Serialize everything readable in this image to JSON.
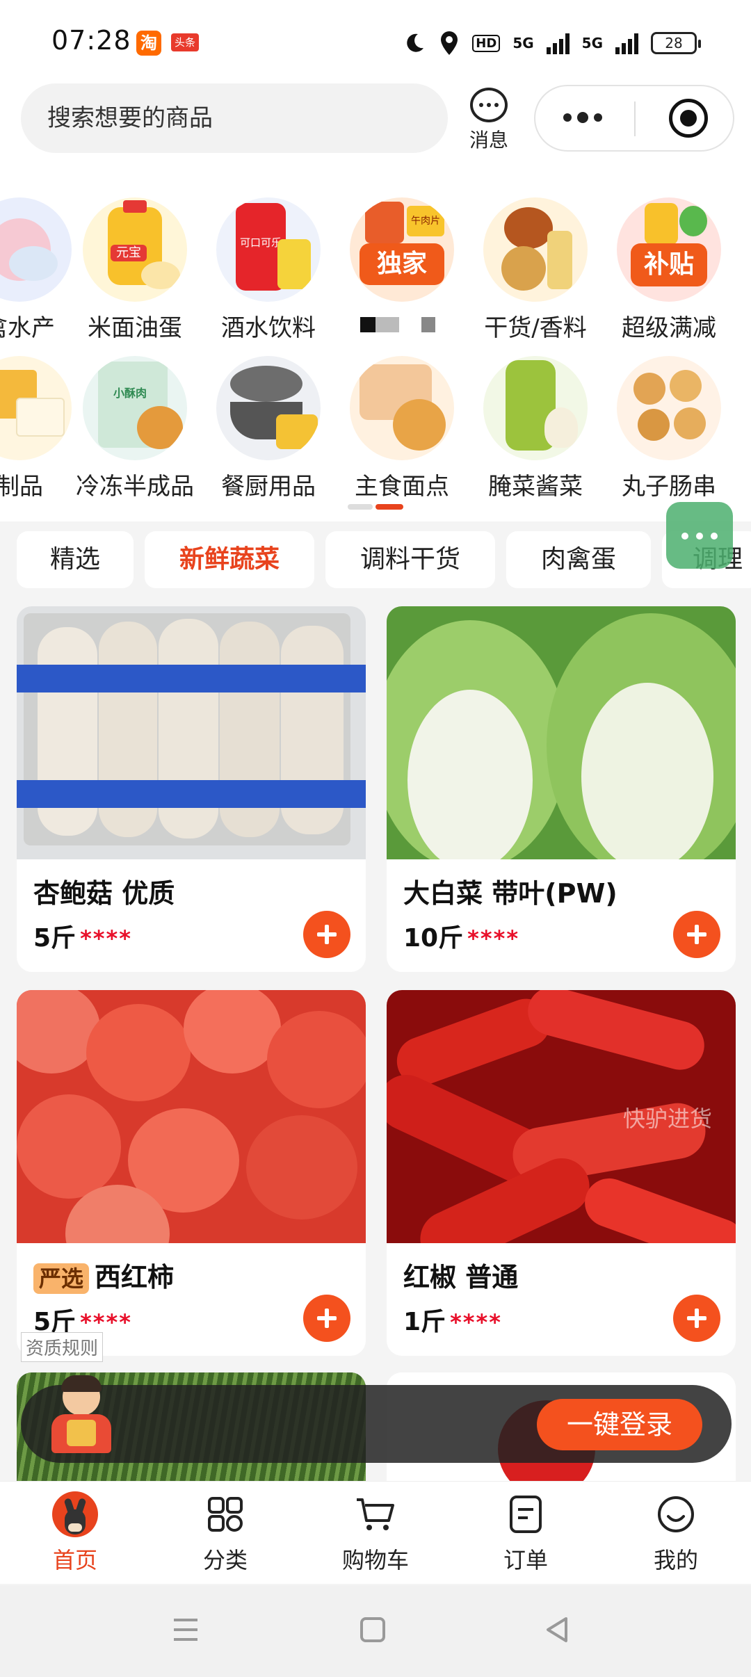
{
  "status_bar": {
    "time": "07:28",
    "taobao_icon": "淘",
    "toutiao_icon": "头条",
    "hd": "HD",
    "signal_1": "5G",
    "signal_2": "5G",
    "battery": "28"
  },
  "header": {
    "search_placeholder": "搜索想要的商品",
    "message_label": "消息"
  },
  "categories": {
    "row1": [
      "禽水产",
      "米面油蛋",
      "酒水饮料",
      "独家",
      "干货/香料",
      "超级满减"
    ],
    "row1_badges": {
      "exclusive": "独家",
      "subsidy": "补贴",
      "brand_yuanbao": "元宝",
      "cola": "可口可乐",
      "ham": "午肉片"
    },
    "row2": [
      "制品",
      "冷冻半成品",
      "餐厨用品",
      "主食面点",
      "腌菜酱菜",
      "丸子肠串"
    ],
    "row2_badges": {
      "small_pork": "小酥肉"
    }
  },
  "tabs": [
    {
      "label": "精选",
      "active": false
    },
    {
      "label": "新鲜蔬菜",
      "active": true
    },
    {
      "label": "调料干货",
      "active": false
    },
    {
      "label": "肉禽蛋",
      "active": false
    },
    {
      "label": "调理",
      "active": false
    }
  ],
  "products": [
    {
      "name": "杏鲍菇 优质",
      "qty": "5斤",
      "price": "****"
    },
    {
      "name": "大白菜 带叶(PW)",
      "qty": "10斤",
      "price": "****"
    },
    {
      "name": "西红柿",
      "badge": "严选",
      "qty": "5斤",
      "price": "****"
    },
    {
      "name": "红椒 普通",
      "qty": "1斤",
      "price": "****",
      "watermark": "快驴进货"
    }
  ],
  "rule_label": "资质规则",
  "login_bar": {
    "button": "一键登录"
  },
  "nav": [
    {
      "label": "首页",
      "icon": "donkey-home-icon",
      "active": true
    },
    {
      "label": "分类",
      "icon": "grid-icon",
      "active": false
    },
    {
      "label": "购物车",
      "icon": "cart-icon",
      "active": false
    },
    {
      "label": "订单",
      "icon": "order-icon",
      "active": false
    },
    {
      "label": "我的",
      "icon": "smile-icon",
      "active": false
    }
  ],
  "colors": {
    "accent": "#e8431d",
    "add_button": "#f4511e",
    "price_star": "#e8102a"
  }
}
